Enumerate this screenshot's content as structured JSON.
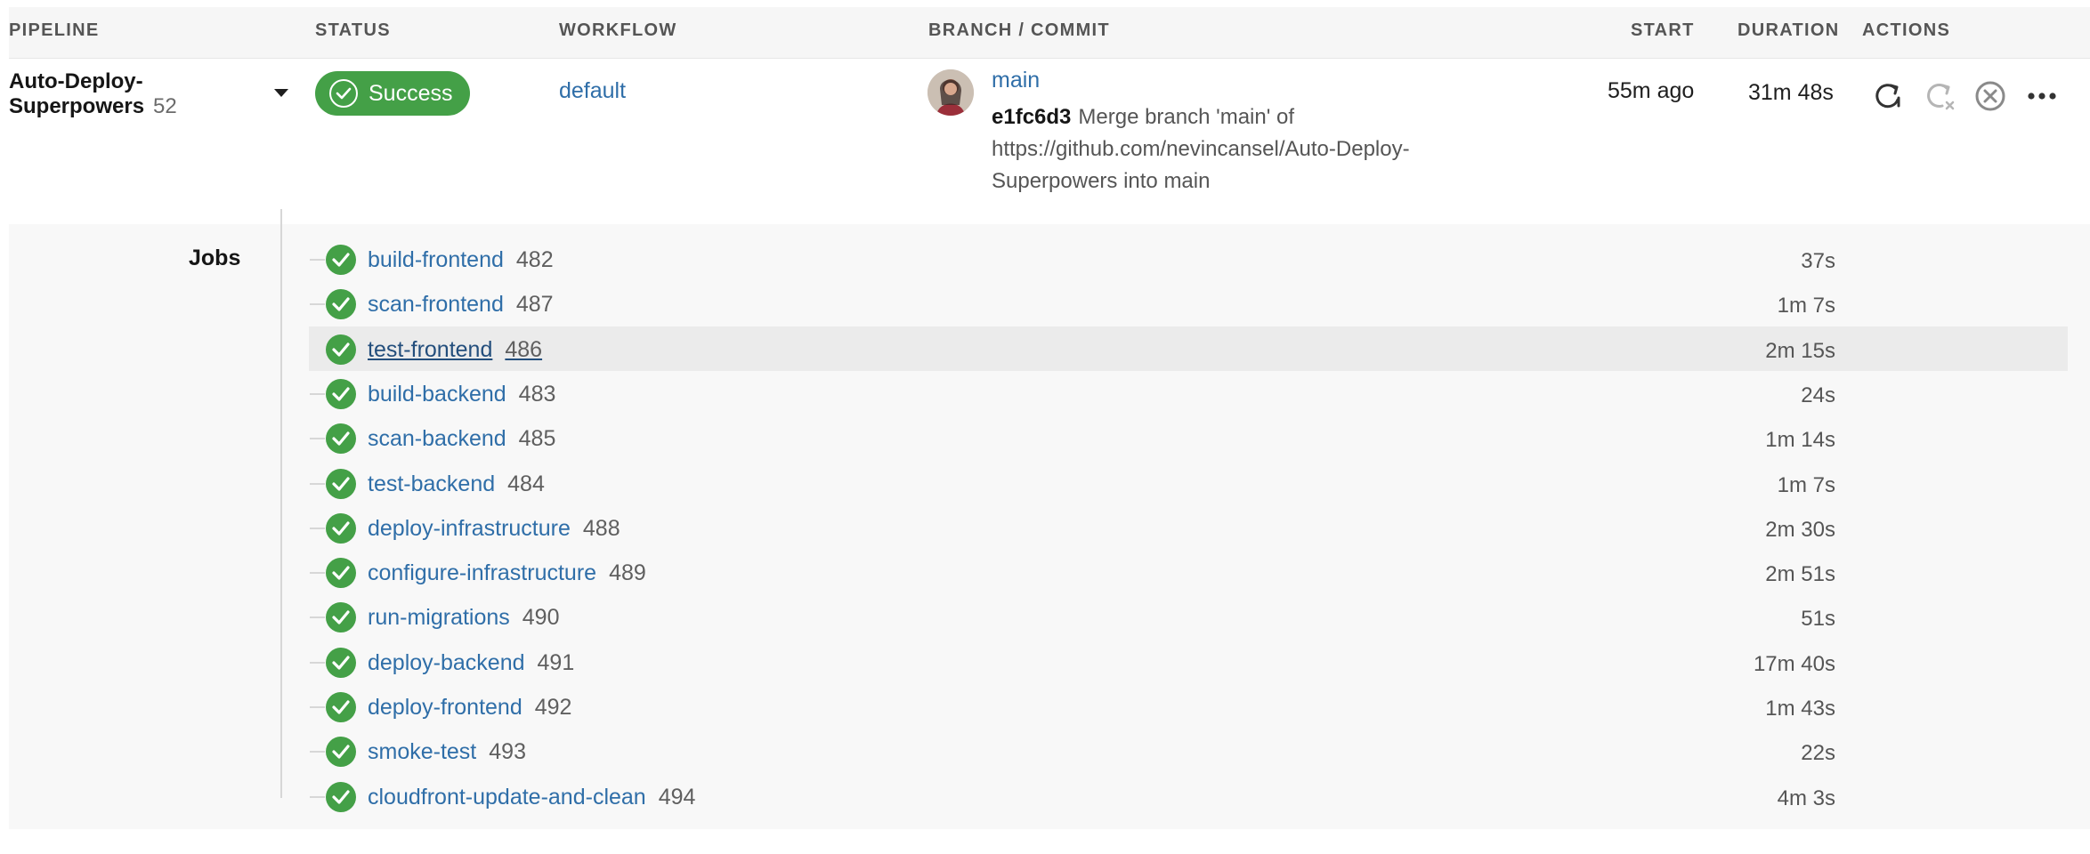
{
  "header": {
    "pipeline": "PIPELINE",
    "status": "STATUS",
    "workflow": "WORKFLOW",
    "branch_commit": "BRANCH / COMMIT",
    "start": "START",
    "duration": "DURATION",
    "actions": "ACTIONS"
  },
  "pipeline": {
    "name": "Auto-Deploy-Superpowers",
    "number": "52",
    "status": "Success",
    "workflow": "default",
    "branch": "main",
    "commit_sha": "e1fc6d3",
    "commit_message": "Merge branch 'main' of https://github.com/nevincansel/Auto-Deploy-Superpowers into main",
    "start": "55m ago",
    "duration": "31m 48s"
  },
  "actions": [
    {
      "icon": "rerun-icon"
    },
    {
      "icon": "rerun-failed-icon"
    },
    {
      "icon": "cancel-icon"
    },
    {
      "icon": "more-options-icon"
    }
  ],
  "jobs_label": "Jobs",
  "jobs": [
    {
      "name": "build-frontend",
      "number": "482",
      "duration": "37s"
    },
    {
      "name": "scan-frontend",
      "number": "487",
      "duration": "1m 7s"
    },
    {
      "name": "test-frontend",
      "number": "486",
      "duration": "2m 15s"
    },
    {
      "name": "build-backend",
      "number": "483",
      "duration": "24s"
    },
    {
      "name": "scan-backend",
      "number": "485",
      "duration": "1m 14s"
    },
    {
      "name": "test-backend",
      "number": "484",
      "duration": "1m 7s"
    },
    {
      "name": "deploy-infrastructure",
      "number": "488",
      "duration": "2m 30s"
    },
    {
      "name": "configure-infrastructure",
      "number": "489",
      "duration": "2m 51s"
    },
    {
      "name": "run-migrations",
      "number": "490",
      "duration": "51s"
    },
    {
      "name": "deploy-backend",
      "number": "491",
      "duration": "17m 40s"
    },
    {
      "name": "deploy-frontend",
      "number": "492",
      "duration": "1m 43s"
    },
    {
      "name": "smoke-test",
      "number": "493",
      "duration": "22s"
    },
    {
      "name": "cloudfront-update-and-clean",
      "number": "494",
      "duration": "4m 3s"
    }
  ],
  "colors": {
    "success": "#44a047",
    "link": "#2f6ea8"
  }
}
